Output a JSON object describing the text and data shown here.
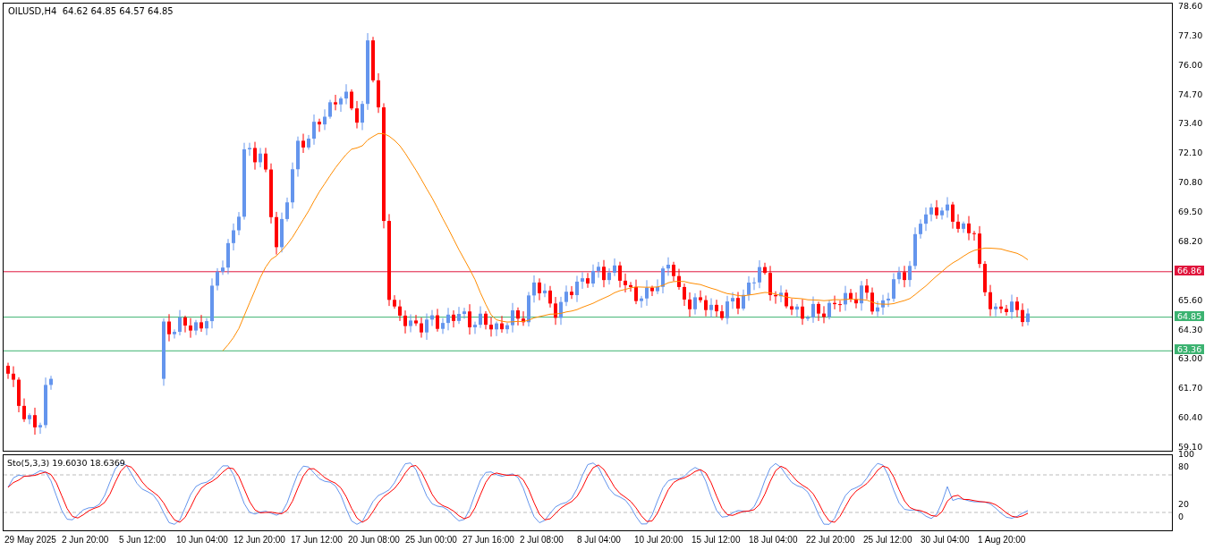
{
  "chart": {
    "symbol": "OILUSD,H4",
    "ohlc": "64.62 64.85 64.57 64.85"
  },
  "price_axis": [
    "78.60",
    "77.30",
    "76.00",
    "74.70",
    "73.40",
    "72.10",
    "70.80",
    "69.50",
    "68.20",
    "65.60",
    "64.30",
    "63.00",
    "61.70",
    "60.40",
    "59.10"
  ],
  "price_lines": [
    {
      "label": "66.86",
      "color": "#e0143c"
    },
    {
      "label": "64.85",
      "color": "#3cb371"
    },
    {
      "label": "63.36",
      "color": "#3cb371"
    }
  ],
  "stochastic": {
    "title": "Sto(5,3,3) 19.6030 18.6369",
    "levels": [
      "100",
      "80",
      "20",
      "0"
    ]
  },
  "time_axis": [
    "29 May 2025",
    "2 Jun 20:00",
    "5 Jun 12:00",
    "10 Jun 04:00",
    "12 Jun 20:00",
    "17 Jun 12:00",
    "20 Jun 08:00",
    "25 Jun 00:00",
    "27 Jun 16:00",
    "2 Jul 08:00",
    "8 Jul 04:00",
    "10 Jul 20:00",
    "15 Jul 12:00",
    "18 Jul 04:00",
    "22 Jul 20:00",
    "25 Jul 12:00",
    "30 Jul 04:00",
    "1 Aug 20:00"
  ]
}
